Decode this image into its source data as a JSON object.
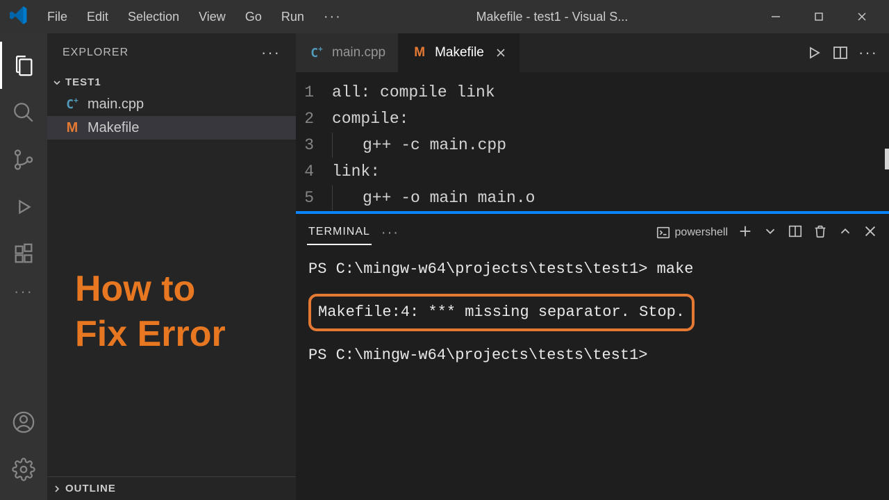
{
  "menu": [
    "File",
    "Edit",
    "Selection",
    "View",
    "Go",
    "Run"
  ],
  "menu_ellipsis": "···",
  "window_title": "Makefile - test1 - Visual S...",
  "sidebar": {
    "header": "EXPLORER",
    "section": "TEST1",
    "files": [
      {
        "icon": "cpp",
        "name": "main.cpp"
      },
      {
        "icon": "mk",
        "name": "Makefile"
      }
    ],
    "outline": "OUTLINE"
  },
  "tabs": [
    {
      "icon": "cpp",
      "label": "main.cpp",
      "active": false
    },
    {
      "icon": "mk",
      "label": "Makefile",
      "active": true,
      "close": true
    }
  ],
  "code": {
    "lines": [
      {
        "n": "1",
        "indent": 0,
        "text": "all: compile link"
      },
      {
        "n": "2",
        "indent": 0,
        "text": "compile:"
      },
      {
        "n": "3",
        "indent": 1,
        "text": "g++ -c main.cpp"
      },
      {
        "n": "4",
        "indent": 0,
        "text": "link:"
      },
      {
        "n": "5",
        "indent": 1,
        "text": "g++ -o main main.o"
      }
    ]
  },
  "terminal": {
    "tab": "TERMINAL",
    "shell": "powershell",
    "line1_prompt": "PS C:\\mingw-w64\\projects\\tests\\test1>",
    "line1_cmd": " make",
    "error": "Makefile:4: *** missing separator.  Stop.",
    "line3_prompt": "PS C:\\mingw-w64\\projects\\tests\\test1>"
  },
  "overlay": {
    "line1": "How to",
    "line2": "Fix Error"
  }
}
